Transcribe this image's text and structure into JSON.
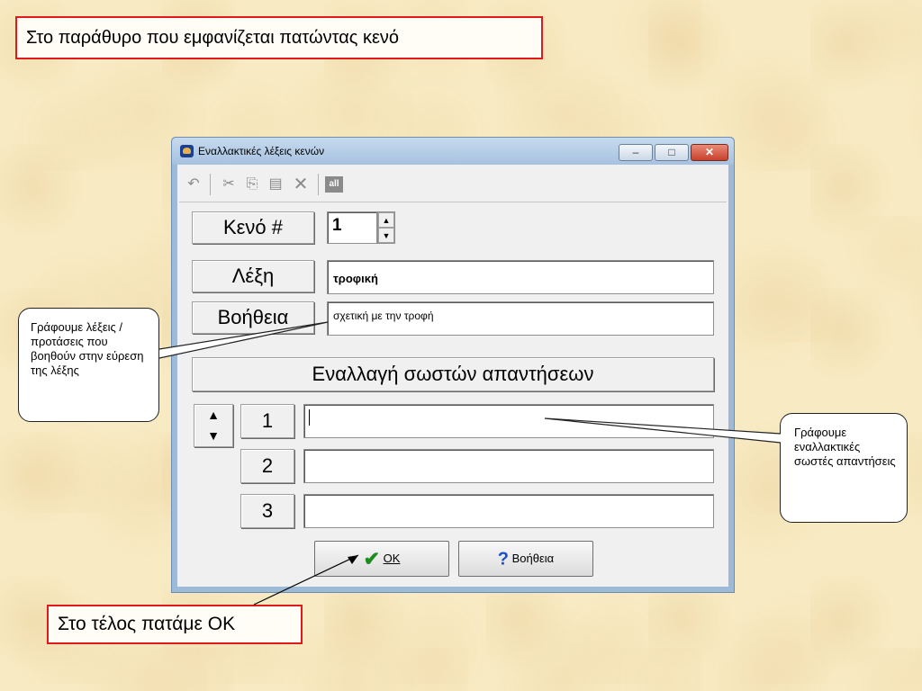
{
  "slide": {
    "title": "Στο παράθυρο που εμφανίζεται πατώντας κενό",
    "left_callout": "Γράφουμε λέξεις /προτάσεις που βοηθούν στην εύρεση της λέξης",
    "right_callout": "Γράφουμε εναλλακτικές σωστές απαντήσεις",
    "bottom_callout": "Στο τέλος πατάμε ΟΚ"
  },
  "window": {
    "title": "Εναλλακτικές λέξεις κενών",
    "minimize_glyph": "–",
    "maximize_glyph": "□",
    "close_glyph": "✕"
  },
  "toolbar": {
    "undo": "↶",
    "cut": "✂",
    "copy": "⎘",
    "paste": "▤",
    "delete": "✕",
    "select_all": "all"
  },
  "form": {
    "gap_label": "Κενό #",
    "gap_value": "1",
    "spin_up": "▲",
    "spin_down": "▼",
    "word_label": "Λέξη",
    "word_value": "τροφική",
    "help_label": "Βοήθεια",
    "help_value": "σχετική με την τροφή",
    "alternatives_header": "Εναλλαγή σωστών απαντήσεων",
    "move_up": "▲",
    "move_down": "▼",
    "alternatives": [
      {
        "number": "1",
        "value": ""
      },
      {
        "number": "2",
        "value": ""
      },
      {
        "number": "3",
        "value": ""
      }
    ]
  },
  "buttons": {
    "ok_icon": "✔",
    "ok_label": "OK",
    "help_icon": "?",
    "help_label": "Βοήθεια"
  }
}
